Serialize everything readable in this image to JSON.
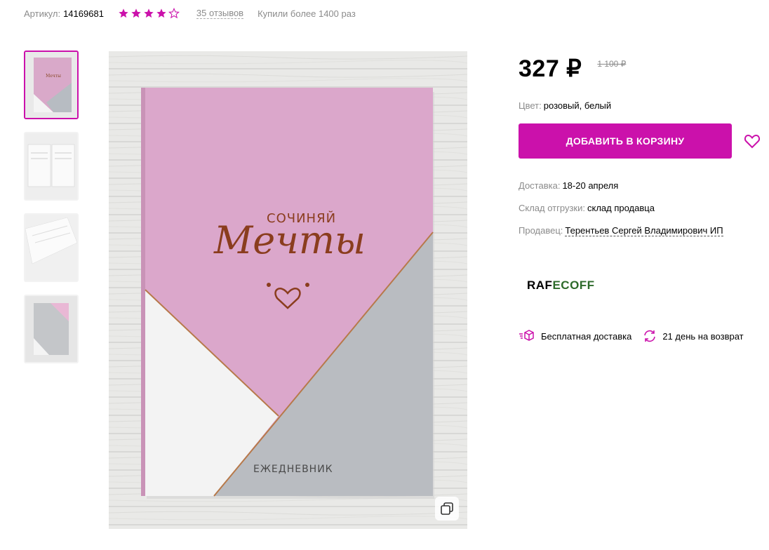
{
  "header": {
    "article_label": "Артикул:",
    "article_value": "14169681",
    "rating": 4,
    "rating_max": 5,
    "reviews": "35 отзывов",
    "bought": "Купили более 1400 раз"
  },
  "gallery": {
    "thumbnails": [
      "thumb-cover",
      "thumb-spread",
      "thumb-pages",
      "thumb-closed"
    ],
    "active_index": 0
  },
  "product_image": {
    "cover_small_text": "СОЧИНЯЙ",
    "cover_script_text": "Мечты",
    "cover_bottom_text": "ЕЖЕДНЕВНИК"
  },
  "pricing": {
    "price": "327 ₽",
    "old_price": "1 100 ₽"
  },
  "color": {
    "label": "Цвет:",
    "value": "розовый, белый"
  },
  "cart": {
    "label": "ДОБАВИТЬ В КОРЗИНУ"
  },
  "delivery": {
    "label": "Доставка:",
    "value": "18-20 апреля"
  },
  "warehouse": {
    "label": "Склад отгрузки:",
    "value": "склад продавца"
  },
  "seller": {
    "label": "Продавец:",
    "value": "Терентьев Сергей Владимирович ИП"
  },
  "brand": {
    "part1": "RAF",
    "part2": "ECOFF"
  },
  "features": {
    "free_delivery": "Бесплатная доставка",
    "returns": "21 день на возврат"
  },
  "colors": {
    "accent": "#cb11ab",
    "star": "#cb11ab",
    "muted": "#8b8b8b"
  }
}
